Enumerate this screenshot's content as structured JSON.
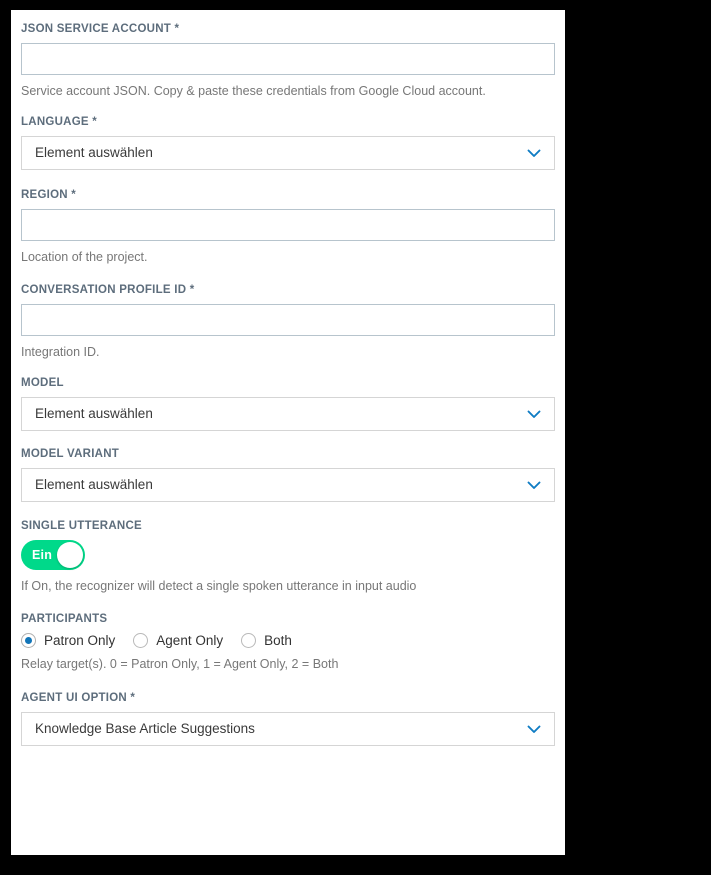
{
  "theme": {
    "panel_bg": "#ffffff",
    "page_bg": "#000000",
    "label_color": "#5d6d7c",
    "help_color": "#777777",
    "input_border": "#b7c4cd",
    "select_border": "#d5d5d5",
    "accent_blue": "#0f7cc4",
    "radio_selected": "#1275b8",
    "toggle_on": "#00d98a"
  },
  "form": {
    "fields": [
      {
        "name": "json-service-account",
        "label": "JSON SERVICE ACCOUNT *",
        "type": "text",
        "value": "",
        "placeholder": "",
        "help": "Service account JSON. Copy & paste these credentials from Google Cloud account."
      },
      {
        "name": "language",
        "label": "LANGUAGE *",
        "type": "select",
        "value": "Element auswählen",
        "help": ""
      },
      {
        "name": "region",
        "label": "REGION *",
        "type": "text",
        "value": "",
        "placeholder": "",
        "help": "Location of the project."
      },
      {
        "name": "conversation-profile-id",
        "label": "CONVERSATION PROFILE ID *",
        "type": "text",
        "value": "",
        "placeholder": "",
        "help": "Integration ID."
      },
      {
        "name": "model",
        "label": "MODEL",
        "type": "select",
        "value": "Element auswählen",
        "help": ""
      },
      {
        "name": "model-variant",
        "label": "MODEL VARIANT",
        "type": "select",
        "value": "Element auswählen",
        "help": ""
      },
      {
        "name": "single-utterance",
        "label": "SINGLE UTTERANCE",
        "type": "toggle",
        "toggle_state": "Ein",
        "toggle_on": true,
        "help": "If On, the recognizer will detect a single spoken utterance in input audio"
      },
      {
        "name": "participants",
        "label": "PARTICIPANTS",
        "type": "radio",
        "options": [
          {
            "label": "Patron Only",
            "checked": true
          },
          {
            "label": "Agent Only",
            "checked": false
          },
          {
            "label": "Both",
            "checked": false
          }
        ],
        "help": "Relay target(s). 0 = Patron Only, 1 = Agent Only, 2 = Both"
      },
      {
        "name": "agent-ui-option",
        "label": "AGENT UI OPTION *",
        "type": "select",
        "value": "Knowledge Base Article Suggestions",
        "help": ""
      }
    ]
  },
  "icons": {
    "dropdown": "chevron-down-icon"
  }
}
